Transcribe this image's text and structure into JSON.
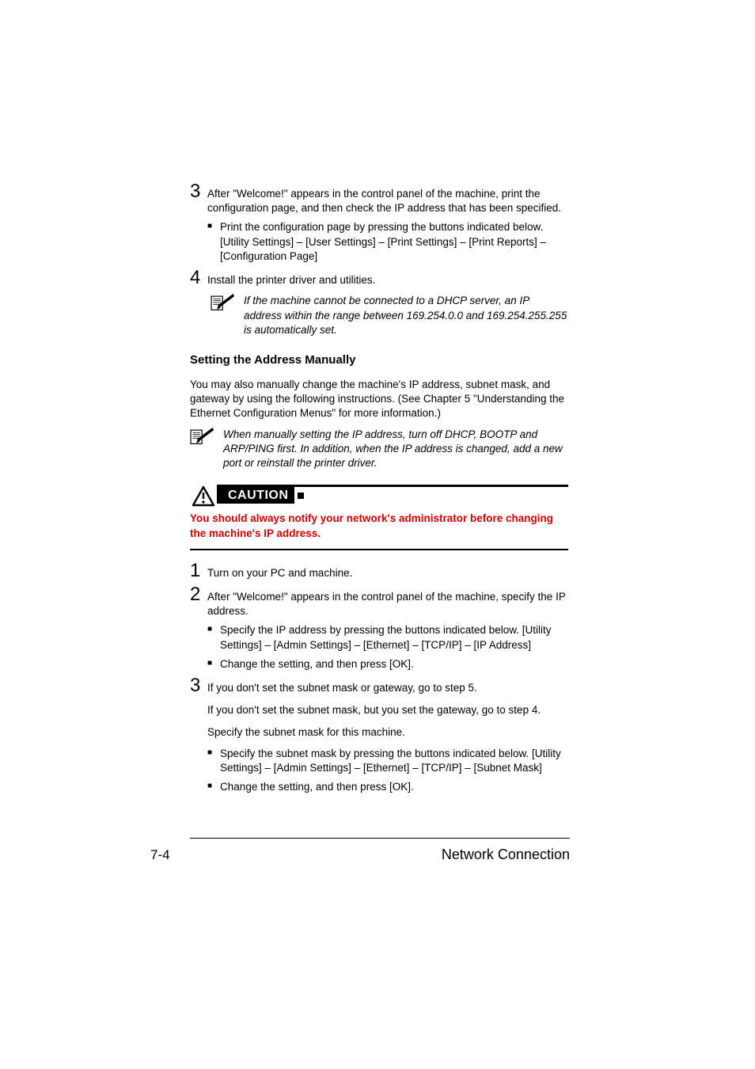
{
  "steps_a": {
    "s3": "After \"Welcome!\" appears in the control panel of the machine, print the configuration page, and then check the IP address that has been specified.",
    "s3_bullet": "Print the configuration page by pressing the buttons indicated below. [Utility Settings] – [User Settings] – [Print Settings] – [Print Reports] – [Configuration Page]",
    "s4": "Install the printer driver and utilities.",
    "s4_note": "If the machine cannot be connected to a DHCP server, an IP address within the range between 169.254.0.0 and 169.254.255.255 is automatically set."
  },
  "section": {
    "heading": "Setting the Address Manually",
    "intro": "You may also manually change the machine's IP address, subnet mask, and gateway by using the following instructions. (See Chapter 5 \"Understanding the Ethernet Configuration Menus\" for more information.)",
    "note": "When manually setting the IP address, turn off DHCP, BOOTP and ARP/PING first. In addition, when the IP address is changed, add a new port or reinstall the printer driver."
  },
  "caution": {
    "label": "CAUTION",
    "body": "You should always notify your network's administrator before changing the machine's IP address."
  },
  "steps_b": {
    "s1": "Turn on your PC and machine.",
    "s2": "After \"Welcome!\" appears in the control panel of the machine, specify the IP address.",
    "s2_b1": "Specify the IP address by pressing the buttons indicated below. [Utility Settings] – [Admin Settings] – [Ethernet] – [TCP/IP] – [IP Address]",
    "s2_b2": "Change the setting, and then press [OK].",
    "s3": "If you don't set the subnet mask or gateway, go to step 5.",
    "s3_p1": "If you don't set the subnet mask, but you set the gateway, go to step 4.",
    "s3_p2": "Specify the subnet mask for this machine.",
    "s3_b1": "Specify the subnet mask by pressing the buttons indicated below. [Utility Settings] – [Admin Settings] – [Ethernet] – [TCP/IP] – [Subnet Mask]",
    "s3_b2": "Change the setting, and then press [OK]."
  },
  "footer": {
    "page": "7-4",
    "title": "Network Connection"
  },
  "nums": {
    "n1": "1",
    "n2": "2",
    "n3": "3",
    "n4": "4"
  }
}
